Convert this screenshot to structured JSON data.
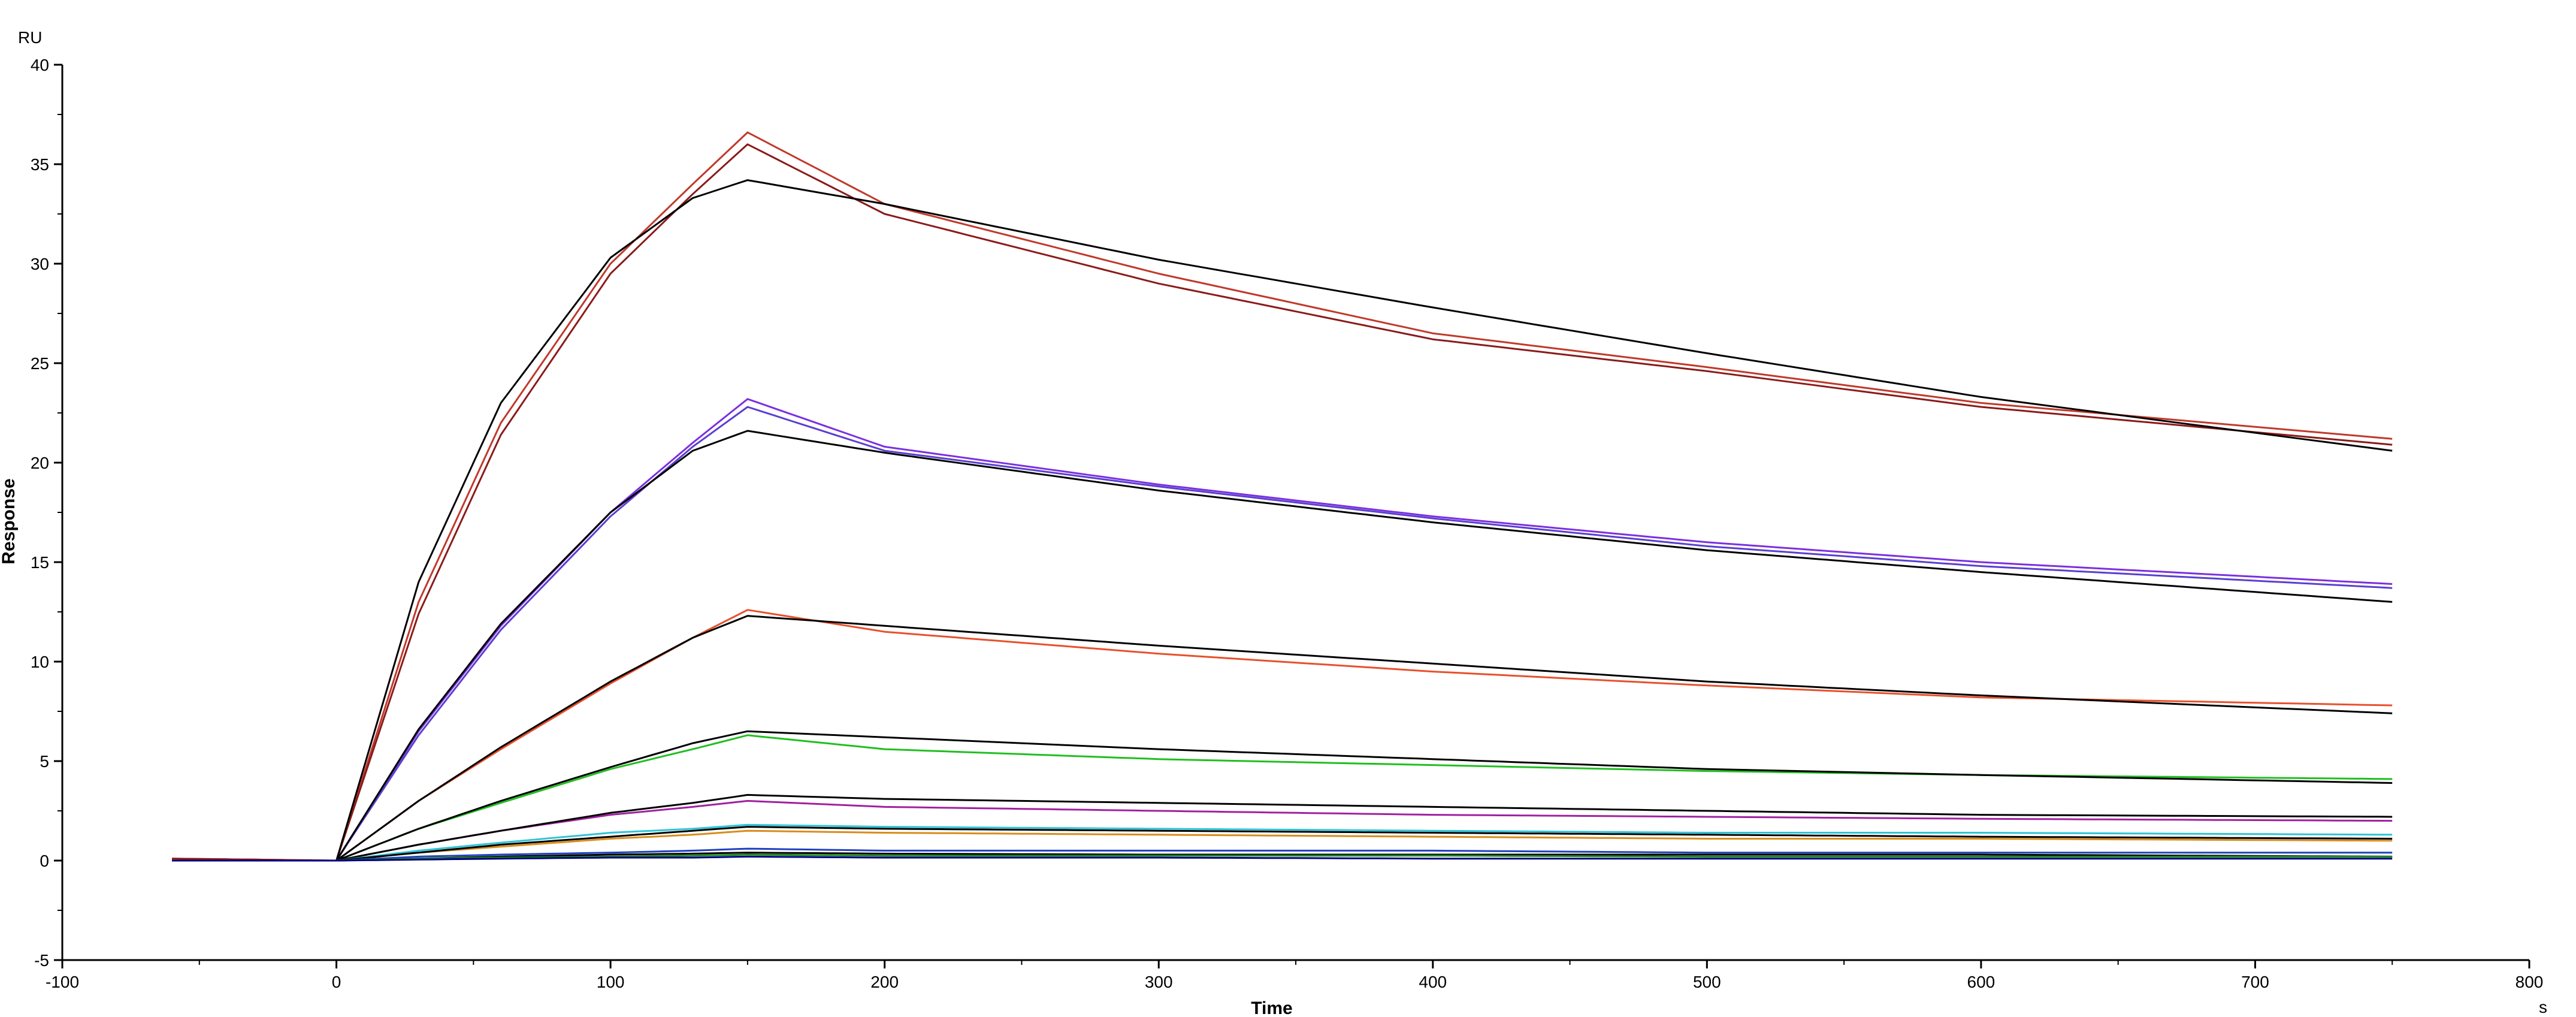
{
  "chart_data": {
    "type": "line",
    "title": "",
    "xlabel": "Time",
    "ylabel": "Response",
    "x_unit": "s",
    "y_unit": "RU",
    "xlim": [
      -100,
      800
    ],
    "ylim": [
      -5,
      40
    ],
    "x_ticks": [
      -100,
      0,
      100,
      200,
      300,
      400,
      500,
      600,
      700,
      800
    ],
    "y_ticks": [
      -5,
      0,
      5,
      10,
      15,
      20,
      25,
      30,
      35,
      40
    ],
    "grid": false,
    "legend": "none",
    "association": {
      "start": 0,
      "end": 150,
      "baseline_start": -60
    },
    "dissociation_end": 750,
    "series": [
      {
        "color": "#c0392b",
        "points": [
          [
            -60,
            0.1
          ],
          [
            0,
            0
          ],
          [
            30,
            13.0
          ],
          [
            60,
            22.0
          ],
          [
            100,
            30.0
          ],
          [
            130,
            34.0
          ],
          [
            150,
            36.6
          ],
          [
            200,
            33.0
          ],
          [
            300,
            29.5
          ],
          [
            400,
            26.5
          ],
          [
            500,
            24.8
          ],
          [
            600,
            23.0
          ],
          [
            750,
            21.2
          ]
        ]
      },
      {
        "color": "#8b1a1a",
        "points": [
          [
            -60,
            0.1
          ],
          [
            0,
            0
          ],
          [
            30,
            12.4
          ],
          [
            60,
            21.4
          ],
          [
            100,
            29.5
          ],
          [
            130,
            33.5
          ],
          [
            150,
            36.0
          ],
          [
            200,
            32.5
          ],
          [
            300,
            29.0
          ],
          [
            400,
            26.2
          ],
          [
            500,
            24.6
          ],
          [
            600,
            22.8
          ],
          [
            750,
            20.9
          ]
        ]
      },
      {
        "color": "#000000",
        "points": [
          [
            -60,
            0
          ],
          [
            0,
            0
          ],
          [
            30,
            14.0
          ],
          [
            60,
            23.0
          ],
          [
            100,
            30.3
          ],
          [
            130,
            33.3
          ],
          [
            150,
            34.2
          ],
          [
            200,
            33.0
          ],
          [
            300,
            30.2
          ],
          [
            400,
            27.8
          ],
          [
            500,
            25.5
          ],
          [
            600,
            23.3
          ],
          [
            750,
            20.6
          ]
        ]
      },
      {
        "color": "#7b2fe0",
        "points": [
          [
            -60,
            0
          ],
          [
            0,
            0
          ],
          [
            30,
            6.5
          ],
          [
            60,
            11.8
          ],
          [
            100,
            17.5
          ],
          [
            130,
            21.0
          ],
          [
            150,
            23.2
          ],
          [
            200,
            20.8
          ],
          [
            300,
            18.9
          ],
          [
            400,
            17.3
          ],
          [
            500,
            16.0
          ],
          [
            600,
            15.0
          ],
          [
            750,
            13.9
          ]
        ]
      },
      {
        "color": "#5a3fcf",
        "points": [
          [
            -60,
            0
          ],
          [
            0,
            0
          ],
          [
            30,
            6.3
          ],
          [
            60,
            11.6
          ],
          [
            100,
            17.3
          ],
          [
            130,
            20.8
          ],
          [
            150,
            22.8
          ],
          [
            200,
            20.6
          ],
          [
            300,
            18.8
          ],
          [
            400,
            17.2
          ],
          [
            500,
            15.8
          ],
          [
            600,
            14.8
          ],
          [
            750,
            13.7
          ]
        ]
      },
      {
        "color": "#000000",
        "points": [
          [
            -60,
            0
          ],
          [
            0,
            0
          ],
          [
            30,
            6.6
          ],
          [
            60,
            11.9
          ],
          [
            100,
            17.5
          ],
          [
            130,
            20.6
          ],
          [
            150,
            21.6
          ],
          [
            200,
            20.5
          ],
          [
            300,
            18.6
          ],
          [
            400,
            17.0
          ],
          [
            500,
            15.6
          ],
          [
            600,
            14.5
          ],
          [
            750,
            13.0
          ]
        ]
      },
      {
        "color": "#e8502b",
        "points": [
          [
            -60,
            0
          ],
          [
            0,
            0
          ],
          [
            30,
            3.0
          ],
          [
            60,
            5.6
          ],
          [
            100,
            8.9
          ],
          [
            130,
            11.2
          ],
          [
            150,
            12.6
          ],
          [
            200,
            11.5
          ],
          [
            300,
            10.4
          ],
          [
            400,
            9.5
          ],
          [
            500,
            8.8
          ],
          [
            600,
            8.2
          ],
          [
            750,
            7.8
          ]
        ]
      },
      {
        "color": "#000000",
        "points": [
          [
            -60,
            0
          ],
          [
            0,
            0
          ],
          [
            30,
            3.0
          ],
          [
            60,
            5.7
          ],
          [
            100,
            9.0
          ],
          [
            130,
            11.2
          ],
          [
            150,
            12.3
          ],
          [
            200,
            11.8
          ],
          [
            300,
            10.8
          ],
          [
            400,
            9.9
          ],
          [
            500,
            9.0
          ],
          [
            600,
            8.3
          ],
          [
            750,
            7.4
          ]
        ]
      },
      {
        "color": "#1fbf1f",
        "points": [
          [
            -60,
            0
          ],
          [
            0,
            0
          ],
          [
            30,
            1.6
          ],
          [
            60,
            2.9
          ],
          [
            100,
            4.6
          ],
          [
            130,
            5.6
          ],
          [
            150,
            6.3
          ],
          [
            200,
            5.6
          ],
          [
            300,
            5.1
          ],
          [
            400,
            4.8
          ],
          [
            500,
            4.5
          ],
          [
            600,
            4.3
          ],
          [
            750,
            4.1
          ]
        ]
      },
      {
        "color": "#000000",
        "points": [
          [
            -60,
            0
          ],
          [
            0,
            0
          ],
          [
            30,
            1.6
          ],
          [
            60,
            3.0
          ],
          [
            100,
            4.7
          ],
          [
            130,
            5.9
          ],
          [
            150,
            6.5
          ],
          [
            200,
            6.2
          ],
          [
            300,
            5.6
          ],
          [
            400,
            5.1
          ],
          [
            500,
            4.6
          ],
          [
            600,
            4.3
          ],
          [
            750,
            3.9
          ]
        ]
      },
      {
        "color": "#a020a0",
        "points": [
          [
            -60,
            0
          ],
          [
            0,
            0
          ],
          [
            30,
            0.8
          ],
          [
            60,
            1.5
          ],
          [
            100,
            2.3
          ],
          [
            130,
            2.7
          ],
          [
            150,
            3.0
          ],
          [
            200,
            2.7
          ],
          [
            300,
            2.5
          ],
          [
            400,
            2.3
          ],
          [
            500,
            2.2
          ],
          [
            600,
            2.1
          ],
          [
            750,
            2.0
          ]
        ]
      },
      {
        "color": "#000000",
        "points": [
          [
            -60,
            0
          ],
          [
            0,
            0
          ],
          [
            30,
            0.8
          ],
          [
            60,
            1.5
          ],
          [
            100,
            2.4
          ],
          [
            130,
            2.9
          ],
          [
            150,
            3.3
          ],
          [
            200,
            3.1
          ],
          [
            300,
            2.9
          ],
          [
            400,
            2.7
          ],
          [
            500,
            2.5
          ],
          [
            600,
            2.3
          ],
          [
            750,
            2.2
          ]
        ]
      },
      {
        "color": "#2ec4d6",
        "points": [
          [
            -60,
            0
          ],
          [
            0,
            0
          ],
          [
            30,
            0.5
          ],
          [
            60,
            0.9
          ],
          [
            100,
            1.4
          ],
          [
            130,
            1.6
          ],
          [
            150,
            1.8
          ],
          [
            200,
            1.7
          ],
          [
            300,
            1.6
          ],
          [
            400,
            1.5
          ],
          [
            500,
            1.4
          ],
          [
            600,
            1.4
          ],
          [
            750,
            1.3
          ]
        ]
      },
      {
        "color": "#d98c1a",
        "points": [
          [
            -60,
            0
          ],
          [
            0,
            0
          ],
          [
            30,
            0.4
          ],
          [
            60,
            0.7
          ],
          [
            100,
            1.1
          ],
          [
            130,
            1.3
          ],
          [
            150,
            1.5
          ],
          [
            200,
            1.4
          ],
          [
            300,
            1.3
          ],
          [
            400,
            1.2
          ],
          [
            500,
            1.1
          ],
          [
            600,
            1.1
          ],
          [
            750,
            1.0
          ]
        ]
      },
      {
        "color": "#000000",
        "points": [
          [
            -60,
            0
          ],
          [
            0,
            0
          ],
          [
            30,
            0.4
          ],
          [
            60,
            0.8
          ],
          [
            100,
            1.2
          ],
          [
            130,
            1.5
          ],
          [
            150,
            1.7
          ],
          [
            200,
            1.6
          ],
          [
            300,
            1.5
          ],
          [
            400,
            1.4
          ],
          [
            500,
            1.3
          ],
          [
            600,
            1.2
          ],
          [
            750,
            1.1
          ]
        ]
      },
      {
        "color": "#2040c0",
        "points": [
          [
            -60,
            0
          ],
          [
            0,
            0
          ],
          [
            30,
            0.2
          ],
          [
            60,
            0.3
          ],
          [
            100,
            0.4
          ],
          [
            130,
            0.5
          ],
          [
            150,
            0.6
          ],
          [
            200,
            0.5
          ],
          [
            300,
            0.5
          ],
          [
            400,
            0.5
          ],
          [
            500,
            0.4
          ],
          [
            600,
            0.4
          ],
          [
            750,
            0.4
          ]
        ]
      },
      {
        "color": "#000000",
        "points": [
          [
            -60,
            0
          ],
          [
            0,
            0
          ],
          [
            30,
            0.1
          ],
          [
            60,
            0.2
          ],
          [
            100,
            0.3
          ],
          [
            130,
            0.35
          ],
          [
            150,
            0.4
          ],
          [
            200,
            0.35
          ],
          [
            300,
            0.3
          ],
          [
            400,
            0.3
          ],
          [
            500,
            0.3
          ],
          [
            600,
            0.3
          ],
          [
            750,
            0.2
          ]
        ]
      },
      {
        "color": "#1a8a1a",
        "points": [
          [
            -60,
            0
          ],
          [
            0,
            0
          ],
          [
            30,
            0.1
          ],
          [
            60,
            0.15
          ],
          [
            100,
            0.2
          ],
          [
            130,
            0.25
          ],
          [
            150,
            0.3
          ],
          [
            200,
            0.25
          ],
          [
            300,
            0.25
          ],
          [
            400,
            0.25
          ],
          [
            500,
            0.2
          ],
          [
            600,
            0.2
          ],
          [
            750,
            0.2
          ]
        ]
      },
      {
        "color": "#000080",
        "points": [
          [
            -60,
            0
          ],
          [
            0,
            0
          ],
          [
            30,
            0.05
          ],
          [
            60,
            0.1
          ],
          [
            100,
            0.15
          ],
          [
            130,
            0.15
          ],
          [
            150,
            0.2
          ],
          [
            200,
            0.15
          ],
          [
            300,
            0.15
          ],
          [
            400,
            0.1
          ],
          [
            500,
            0.1
          ],
          [
            600,
            0.1
          ],
          [
            750,
            0.1
          ]
        ]
      }
    ]
  }
}
